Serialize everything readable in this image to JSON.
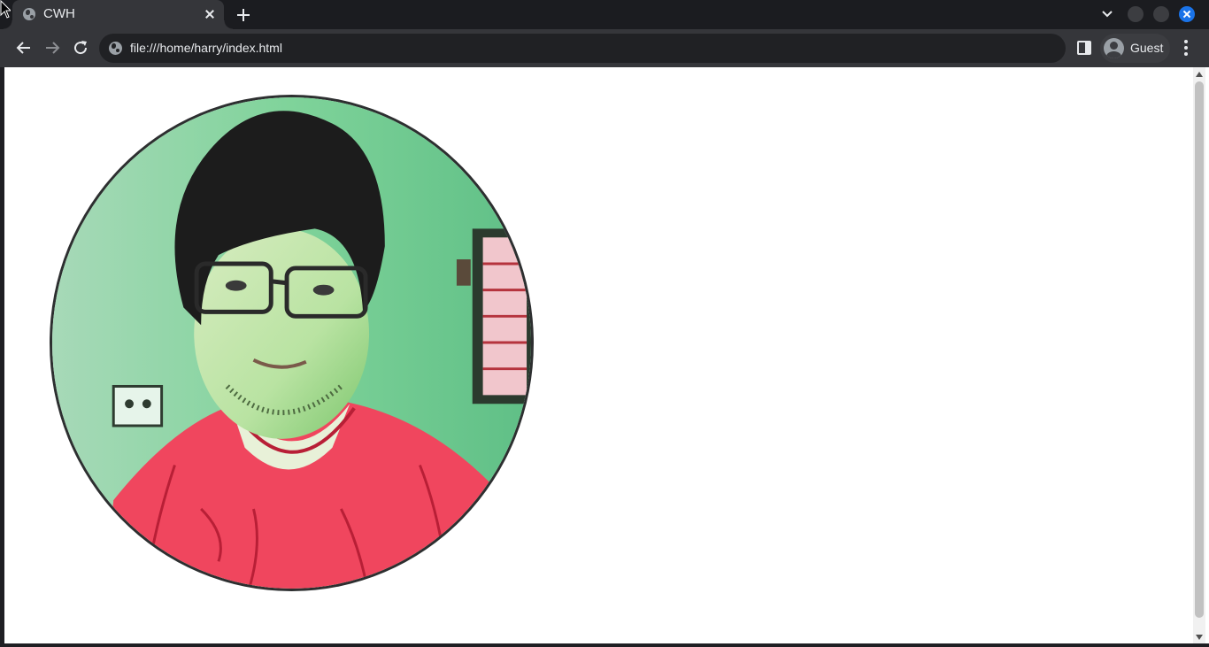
{
  "tab": {
    "title": "CWH"
  },
  "address_bar": {
    "url": "file:///home/harry/index.html"
  },
  "profile": {
    "label": "Guest"
  },
  "colors": {
    "accent": "#1a73e8",
    "frame": "#1b1c20",
    "toolbar": "#35363a"
  },
  "icons": {
    "favicon": "globe-icon",
    "back": "arrow-left-icon",
    "forward": "arrow-right-icon",
    "reload": "reload-icon",
    "side_panel": "side-panel-icon",
    "menu": "kebab-menu-icon"
  },
  "page": {
    "image": "circular-portrait-photo"
  }
}
